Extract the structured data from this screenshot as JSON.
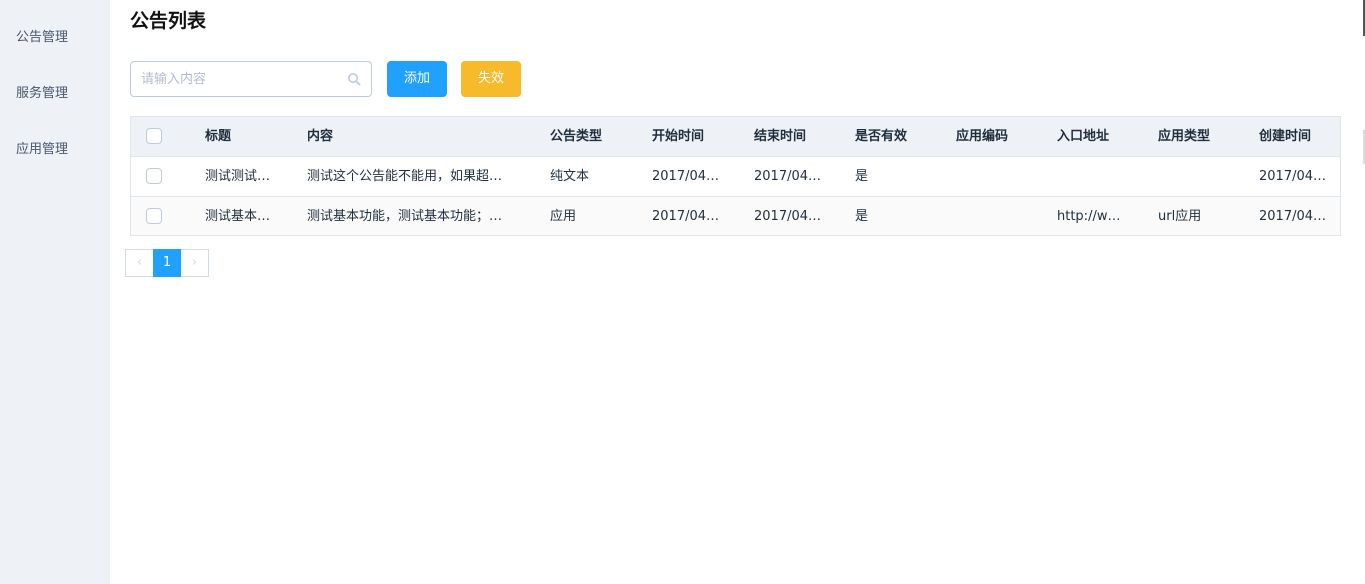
{
  "colors": {
    "primary": "#20a0ff",
    "warning": "#f7ba2a",
    "sidebar_bg": "#eef1f6"
  },
  "sidebar": {
    "items": [
      {
        "label": "公告管理"
      },
      {
        "label": "服务管理"
      },
      {
        "label": "应用管理"
      }
    ]
  },
  "page": {
    "title": "公告列表"
  },
  "search": {
    "placeholder": "请输入内容",
    "value": "",
    "icon": "search-icon"
  },
  "toolbar": {
    "add_label": "添加",
    "invalid_label": "失效"
  },
  "table": {
    "columns": [
      "标题",
      "内容",
      "公告类型",
      "开始时间",
      "结束时间",
      "是否有效",
      "应用编码",
      "入口地址",
      "应用类型",
      "创建时间"
    ],
    "rows": [
      [
        "测试测试…",
        "测试这个公告能不能用，如果超…",
        "纯文本",
        "2017/04…",
        "2017/04…",
        "是",
        "",
        "",
        "",
        "2017/04…"
      ],
      [
        "测试基本…",
        "测试基本功能，测试基本功能；…",
        "应用",
        "2017/04…",
        "2017/04…",
        "是",
        "",
        "http://w…",
        "url应用",
        "2017/04…"
      ]
    ]
  },
  "pagination": {
    "prev": "‹",
    "current": "1",
    "next": "›"
  }
}
